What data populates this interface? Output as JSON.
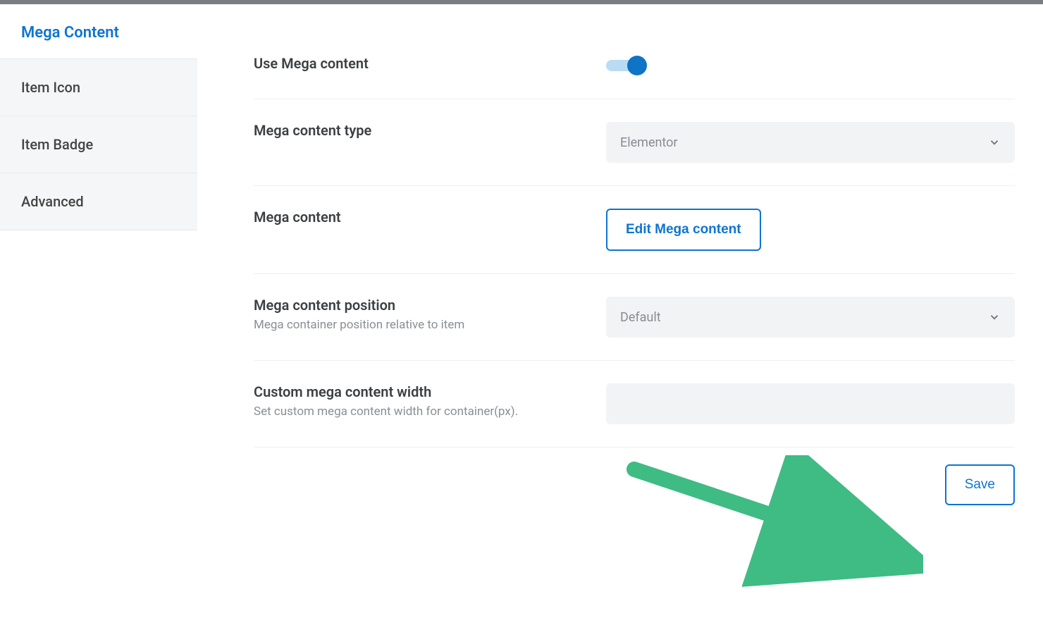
{
  "sidebar": {
    "active_tab": "Mega Content",
    "items": [
      {
        "label": "Item Icon"
      },
      {
        "label": "Item Badge"
      },
      {
        "label": "Advanced"
      }
    ]
  },
  "settings": {
    "use_mega": {
      "label": "Use Mega content",
      "enabled": true
    },
    "type": {
      "label": "Mega content type",
      "selected": "Elementor"
    },
    "content": {
      "label": "Mega content",
      "button_label": "Edit Mega content"
    },
    "position": {
      "label": "Mega content position",
      "description": "Mega container position relative to item",
      "selected": "Default"
    },
    "custom_width": {
      "label": "Custom mega content width",
      "description": "Set custom mega content width for container(px).",
      "value": ""
    }
  },
  "footer": {
    "save_label": "Save"
  },
  "colors": {
    "accent": "#0e74d1",
    "arrow": "#3fbb84"
  }
}
